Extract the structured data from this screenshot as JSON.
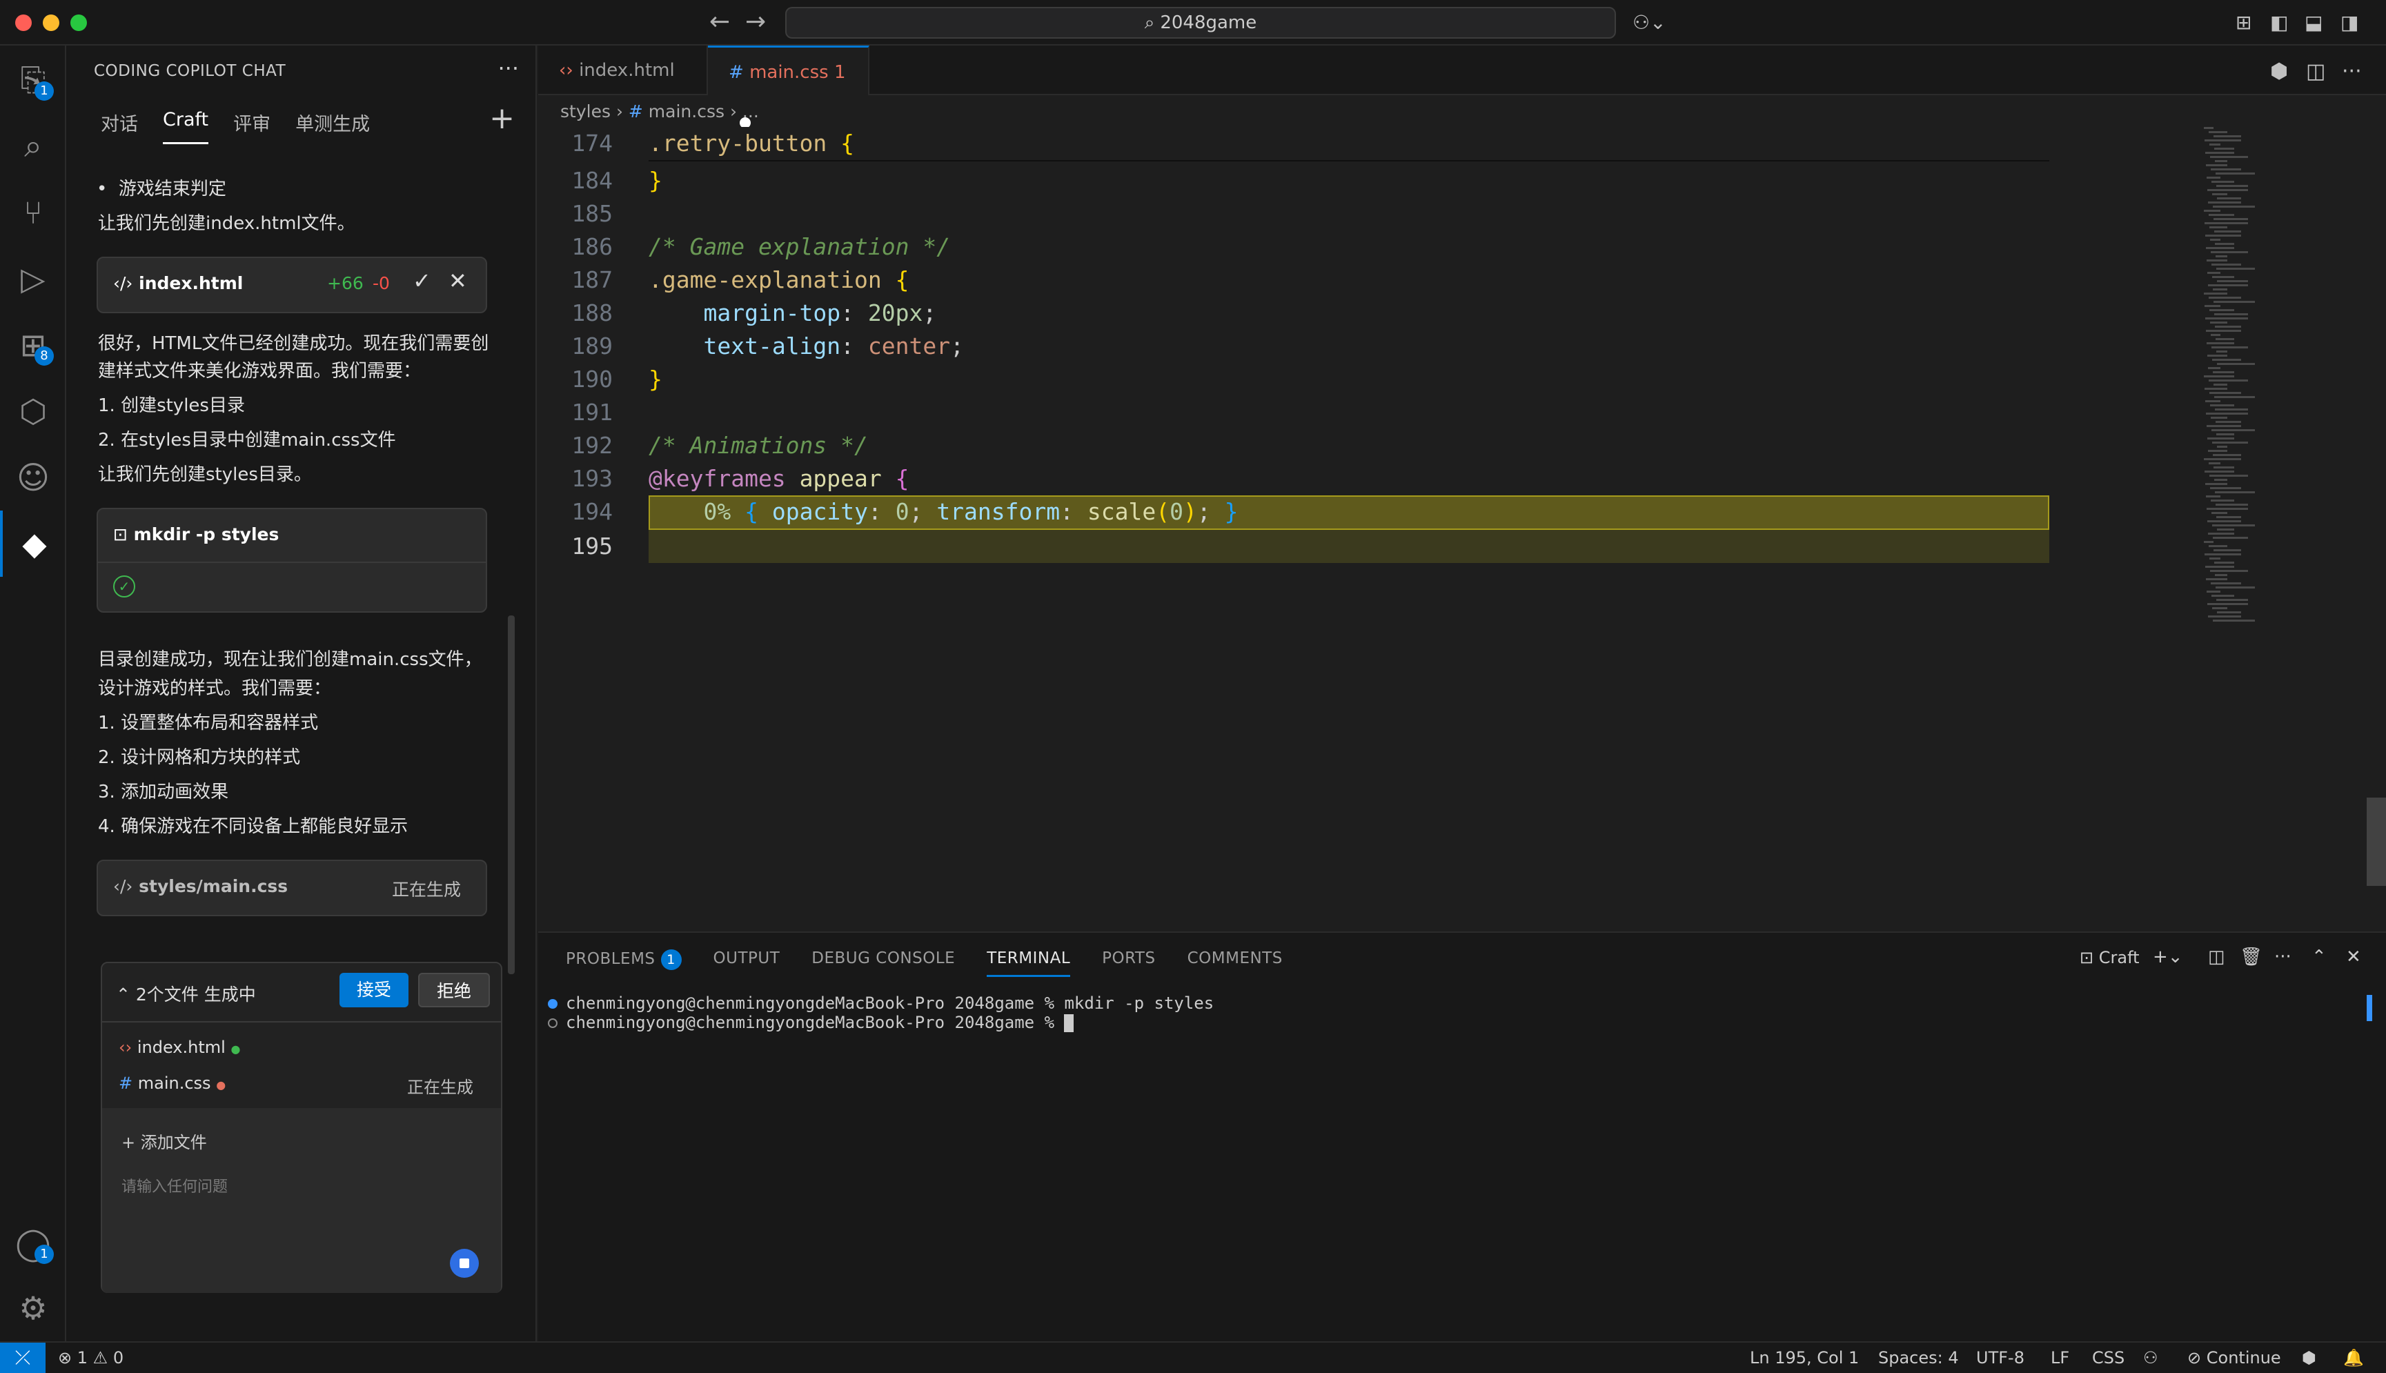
{
  "window": {
    "title": "2048game"
  },
  "activity_bar": {
    "items": [
      {
        "name": "explorer",
        "icon": "files-icon",
        "badge": "1"
      },
      {
        "name": "search",
        "icon": "search-icon"
      },
      {
        "name": "source-control",
        "icon": "source-control-icon"
      },
      {
        "name": "run-debug",
        "icon": "run-debug-icon"
      },
      {
        "name": "extensions",
        "icon": "extensions-icon",
        "badge": "8"
      },
      {
        "name": "remote",
        "icon": "remote-icon"
      },
      {
        "name": "copilot",
        "icon": "robot-icon"
      },
      {
        "name": "craft",
        "icon": "craft-icon"
      }
    ],
    "account_badge": "1"
  },
  "sidebar": {
    "title": "CODING COPILOT CHAT",
    "tabs": [
      "对话",
      "Craft",
      "评审",
      "单测生成"
    ],
    "active_tab": "Craft",
    "messages": {
      "bullet": "游戏结束判定",
      "m1": "让我们先创建index.html文件。",
      "m2_l1": "很好，HTML文件已经创建成功。现在我们需要创",
      "m2_l2": "建样式文件来美化游戏界面。我们需要：",
      "m2_l3": "1. 创建styles目录",
      "m2_l4": "2. 在styles目录中创建main.css文件",
      "m2_l5": "让我们先创建styles目录。",
      "m3_l1": "目录创建成功，现在让我们创建main.css文件，",
      "m3_l2": "设计游戏的样式。我们需要：",
      "m3_l3": "1. 设置整体布局和容器样式",
      "m3_l4": "2. 设计网格和方块的样式",
      "m3_l5": "3. 添加动画效果",
      "m3_l6": "4. 确保游戏在不同设备上都能良好显示"
    },
    "file_card": {
      "name": "index.html",
      "added": "+66",
      "removed": "-0"
    },
    "command_card": {
      "command": "mkdir -p styles"
    },
    "gen_card": {
      "name": "styles/main.css",
      "status": "正在生成"
    },
    "gen_panel": {
      "title": "2个文件 生成中",
      "accept": "接受",
      "reject": "拒绝",
      "files": [
        {
          "name": "index.html",
          "status": ""
        },
        {
          "name": "main.css",
          "status": "正在生成"
        }
      ],
      "add_file": "+ 添加文件",
      "input_placeholder": "请输入任何问题"
    }
  },
  "editor": {
    "tabs": [
      {
        "label": "index.html",
        "icon": "html-icon"
      },
      {
        "label": "main.css",
        "problems": "1",
        "icon": "css-hash-icon"
      }
    ],
    "breadcrumb": {
      "folder": "styles",
      "file": "main.css",
      "more": "..."
    },
    "lines": [
      {
        "num": "174",
        "t": [
          [
            "sel",
            ".retry-button "
          ],
          [
            "brace",
            "{"
          ]
        ]
      },
      {
        "num": "184",
        "t": [
          [
            "brace",
            "}"
          ]
        ]
      },
      {
        "num": "185",
        "t": []
      },
      {
        "num": "186",
        "t": [
          [
            "cmt",
            "/* Game explanation */"
          ]
        ]
      },
      {
        "num": "187",
        "t": [
          [
            "sel",
            ".game-explanation "
          ],
          [
            "brace",
            "{"
          ]
        ]
      },
      {
        "num": "188",
        "t": [
          [
            "",
            "    "
          ],
          [
            "prop",
            "margin-top"
          ],
          [
            "",
            ": "
          ],
          [
            "val",
            "20px"
          ],
          [
            "",
            ";"
          ]
        ]
      },
      {
        "num": "189",
        "t": [
          [
            "",
            "    "
          ],
          [
            "prop",
            "text-align"
          ],
          [
            "",
            ": "
          ],
          [
            "kw",
            "center"
          ],
          [
            "",
            ";"
          ]
        ]
      },
      {
        "num": "190",
        "t": [
          [
            "brace",
            "}"
          ]
        ]
      },
      {
        "num": "191",
        "t": []
      },
      {
        "num": "192",
        "t": [
          [
            "cmt",
            "/* Animations */"
          ]
        ]
      },
      {
        "num": "193",
        "t": [
          [
            "at",
            "@keyframes"
          ],
          [
            "",
            " "
          ],
          [
            "name",
            "appear"
          ],
          [
            "",
            " "
          ],
          [
            "brace2",
            "{"
          ]
        ]
      },
      {
        "num": "194",
        "t": [
          [
            "",
            "    "
          ],
          [
            "val",
            "0%"
          ],
          [
            "",
            " "
          ],
          [
            "brace3",
            "{"
          ],
          [
            "",
            " "
          ],
          [
            "prop",
            "opacity"
          ],
          [
            "",
            ": "
          ],
          [
            "val",
            "0"
          ],
          [
            "",
            "; "
          ],
          [
            "prop",
            "transform"
          ],
          [
            "",
            ": "
          ],
          [
            "name",
            "scale"
          ],
          [
            "brace",
            "("
          ],
          [
            "val",
            "0"
          ],
          [
            "brace",
            ")"
          ],
          [
            "",
            "; "
          ],
          [
            "brace3",
            "}"
          ]
        ]
      },
      {
        "num": "195",
        "t": []
      }
    ]
  },
  "panel": {
    "tabs": [
      "PROBLEMS",
      "OUTPUT",
      "DEBUG CONSOLE",
      "TERMINAL",
      "PORTS",
      "COMMENTS"
    ],
    "active_tab": "TERMINAL",
    "problems_count": "1",
    "terminal_name": "Craft",
    "terminal_lines": [
      "chenmingyong@chenmingyongdeMacBook-Pro 2048game % mkdir -p styles",
      "chenmingyong@chenmingyongdeMacBook-Pro 2048game % "
    ]
  },
  "statusbar": {
    "errors": "1",
    "warnings": "0",
    "position": "Ln 195, Col 1",
    "spaces": "Spaces: 4",
    "encoding": "UTF-8",
    "eol": "LF",
    "language": "CSS",
    "continue": "Continue"
  },
  "colors": {
    "accent": "#0078d4",
    "modified_tab": "#e4705d",
    "highlight": "#5f5a1c"
  }
}
